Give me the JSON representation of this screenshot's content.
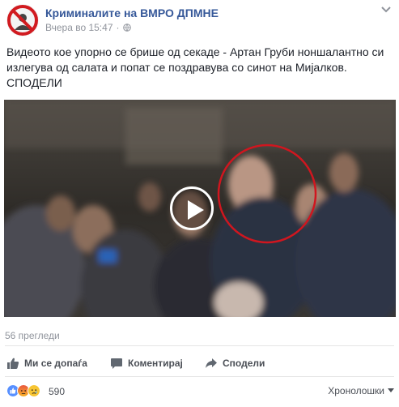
{
  "header": {
    "page_name": "Криминалите на ВМРО ДПМНЕ",
    "timestamp": "Вчера во 15:47",
    "separator": "·",
    "privacy_icon": "globe-icon",
    "menu_icon": "chevron-down-icon"
  },
  "post": {
    "text_line1": "Видеото кое упорно се брише од секаде - Артан Груби ноншалантно си",
    "text_line2": "излегува од салата и попат се поздравува со синот на Мијалков.",
    "text_line3": "СПОДЕЛИ"
  },
  "video": {
    "play_icon": "play-icon",
    "views": "56 прегледи"
  },
  "actions": {
    "like_label": "Ми се допаѓа",
    "comment_label": "Коментирај",
    "share_label": "Сподели"
  },
  "reactions": {
    "count": "590",
    "sort_label": "Хронолошки",
    "icons": [
      "like-reaction-icon",
      "angry-reaction-icon",
      "sad-reaction-icon"
    ]
  },
  "colors": {
    "link": "#365899",
    "muted": "#90949c",
    "action": "#4b4f56",
    "highlight_circle": "#d0161f"
  }
}
